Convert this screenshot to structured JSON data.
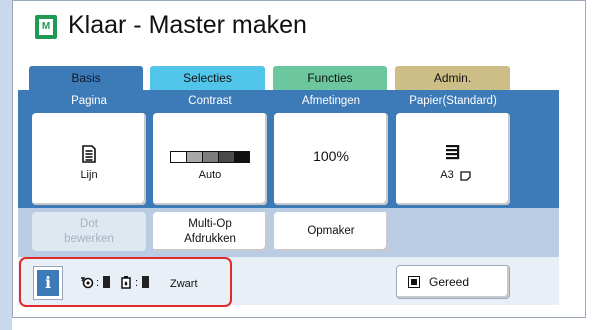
{
  "title": "Klaar - Master maken",
  "title_icon_label": "M",
  "tabs": {
    "basis": "Basis",
    "selecties": "Selecties",
    "functies": "Functies",
    "admin": "Admin."
  },
  "settings": {
    "pagina": {
      "label": "Pagina",
      "value": "Lijn"
    },
    "contrast": {
      "label": "Contrast",
      "value": "Auto"
    },
    "afmetingen": {
      "label": "Afmetingen",
      "value": "100%"
    },
    "papier": {
      "label": "Papier(Standard)",
      "value": "A3"
    }
  },
  "lower_buttons": {
    "dot_bewerken": {
      "line1": "Dot",
      "line2": "bewerken"
    },
    "multi_op": {
      "line1": "Multi-Op",
      "line2": "Afdrukken"
    },
    "opmaker": "Opmaker"
  },
  "status": {
    "info_label": "i",
    "ink_colon_1": ":",
    "ink_colon_2": ":",
    "color": "Zwart"
  },
  "gereed": "Gereed",
  "colors": {
    "accent_blue": "#3d7ab8",
    "tab_selecties": "#51c6ea",
    "tab_functies": "#6cc79e",
    "tab_admin": "#cdbd86",
    "title_icon": "#1f9a55",
    "highlight_red": "#e02a2a"
  }
}
